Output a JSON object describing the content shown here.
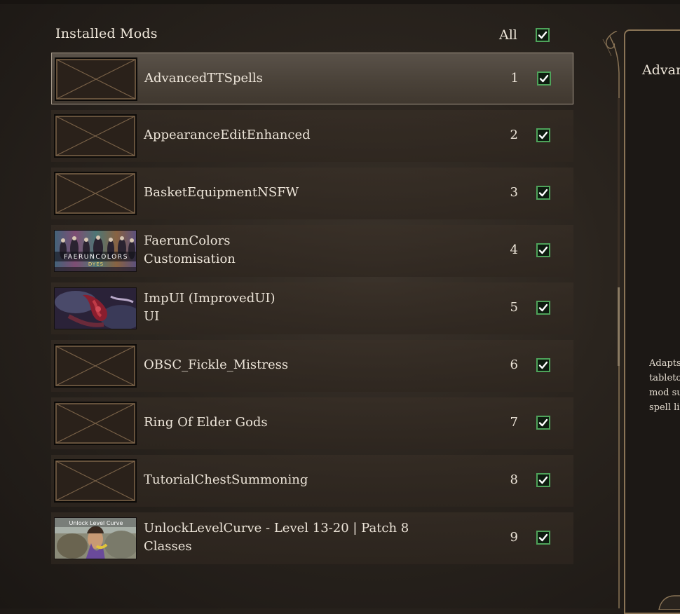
{
  "header": {
    "title": "Installed Mods",
    "all_label": "All"
  },
  "mods": [
    {
      "name": "AdvancedTTSpells",
      "subtitle": "",
      "order": "1",
      "enabled": true,
      "thumbnail": "placeholder",
      "selected": true
    },
    {
      "name": "AppearanceEditEnhanced",
      "subtitle": "",
      "order": "2",
      "enabled": true,
      "thumbnail": "placeholder"
    },
    {
      "name": "BasketEquipmentNSFW",
      "subtitle": "",
      "order": "3",
      "enabled": true,
      "thumbnail": "placeholder"
    },
    {
      "name": "FaerunColors",
      "subtitle": "Customisation",
      "order": "4",
      "enabled": true,
      "thumbnail": "faeruncolors-banner",
      "thumb_text": "FAERUNCOLORS",
      "thumb_text2": "DYES"
    },
    {
      "name": "ImpUI (ImprovedUI)",
      "subtitle": "UI",
      "order": "5",
      "enabled": true,
      "thumbnail": "impui-art"
    },
    {
      "name": "OBSC_Fickle_Mistress",
      "subtitle": "",
      "order": "6",
      "enabled": true,
      "thumbnail": "placeholder"
    },
    {
      "name": "Ring Of Elder Gods",
      "subtitle": "",
      "order": "7",
      "enabled": true,
      "thumbnail": "placeholder"
    },
    {
      "name": "TutorialChestSummoning",
      "subtitle": "",
      "order": "8",
      "enabled": true,
      "thumbnail": "placeholder"
    },
    {
      "name": "UnlockLevelCurve - Level 13-20 | Patch 8",
      "subtitle": "Classes",
      "order": "9",
      "enabled": true,
      "thumbnail": "unlocklevelcurve-art",
      "thumb_text": "Unlock Level Curve"
    }
  ],
  "detail": {
    "title_visible": "Advan",
    "description_lines": [
      "Adapts",
      "tableto",
      "mod su",
      "spell lis"
    ]
  },
  "colors": {
    "checkbox_border": "#4ea35a",
    "check_mark": "#ffffff",
    "selected_row_border": "#a69a8a",
    "panel_border": "#8a7456"
  }
}
